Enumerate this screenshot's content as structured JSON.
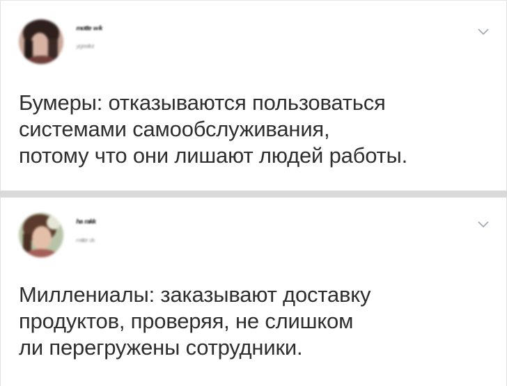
{
  "posts": [
    {
      "author_name": "ᵐᵒᵗᵗᵉ ʷⁱᵏ",
      "author_date": "ʸʳᵍʳᵉᵃᶠʳᵘᵗ",
      "text_lines": [
        "Бумеры: отказываются пользоваться",
        "системами самообслуживания,",
        "потому что они лишают людей работы."
      ]
    },
    {
      "author_name": "ʰᵃ ʳᵃᵏᵏ",
      "author_date": "ᵐᵃᵗᵗᵉʳ ᵈᵃ",
      "text_lines": [
        "Миллениалы: заказывают доставку",
        "продуктов, проверяя, не слишком",
        "ли перегружены сотрудники."
      ]
    }
  ],
  "icons": {
    "menu": "chevron-down-icon"
  },
  "colors": {
    "background": "#d9d9d9",
    "card": "#ffffff",
    "text": "#2e2e2e",
    "chevron": "#9aa7b4"
  }
}
